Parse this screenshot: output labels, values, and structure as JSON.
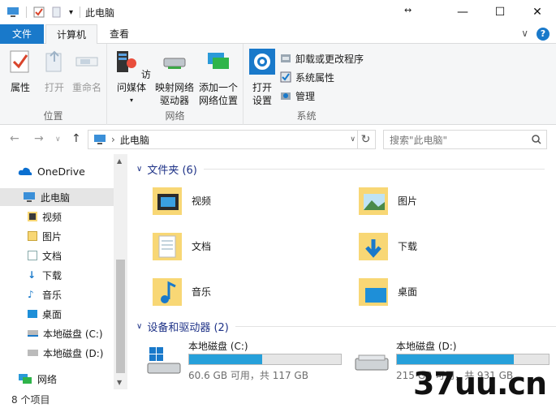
{
  "window": {
    "title": "此电脑",
    "quick_access_dropdown": "▾",
    "controls": {
      "minimize": "—",
      "maximize": "☐",
      "close": "✕"
    },
    "resize_glyph": "↔"
  },
  "tabs": {
    "file": "文件",
    "computer": "计算机",
    "view": "查看",
    "collapse_glyph": "∨",
    "help_glyph": "?"
  },
  "ribbon": {
    "location": {
      "label": "位置",
      "buttons": [
        {
          "label": "属性",
          "icon": "checklist-icon",
          "enabled": true
        },
        {
          "label": "打开",
          "icon": "open-icon",
          "enabled": false
        },
        {
          "label": "重命名",
          "icon": "rename-icon",
          "enabled": false
        }
      ]
    },
    "network": {
      "label": "网络",
      "buttons": [
        {
          "label": "访问媒体",
          "icon": "media-server-icon"
        },
        {
          "label": "映射网络",
          "label2": "驱动器",
          "icon": "map-network-drive-icon"
        },
        {
          "label": "添加一个",
          "label2": "网络位置",
          "icon": "add-network-location-icon"
        }
      ]
    },
    "system": {
      "label": "系统",
      "open_settings": {
        "label": "打开",
        "label2": "设置",
        "icon": "gear-icon"
      },
      "small": [
        {
          "label": "卸载或更改程序",
          "icon": "uninstall-icon"
        },
        {
          "label": "系统属性",
          "icon": "system-properties-icon"
        },
        {
          "label": "管理",
          "icon": "manage-icon"
        }
      ]
    }
  },
  "address": {
    "path": "此电脑",
    "search_placeholder": "搜索\"此电脑\""
  },
  "nav": {
    "onedrive": "OneDrive",
    "this_pc": "此电脑",
    "items": [
      "视频",
      "图片",
      "文档",
      "下载",
      "音乐",
      "桌面",
      "本地磁盘 (C:)",
      "本地磁盘 (D:)"
    ],
    "network": "网络"
  },
  "content": {
    "folders_header": "文件夹 (6)",
    "folders": [
      {
        "name": "视频",
        "icon": "videos-folder-icon"
      },
      {
        "name": "图片",
        "icon": "pictures-folder-icon"
      },
      {
        "name": "文档",
        "icon": "documents-folder-icon"
      },
      {
        "name": "下载",
        "icon": "downloads-folder-icon"
      },
      {
        "name": "音乐",
        "icon": "music-folder-icon"
      },
      {
        "name": "桌面",
        "icon": "desktop-folder-icon"
      }
    ],
    "drives_header": "设备和驱动器 (2)",
    "drives": [
      {
        "name": "本地磁盘 (C:)",
        "info": "60.6 GB 可用，共 117 GB",
        "used_fraction": 0.48
      },
      {
        "name": "本地磁盘 (D:)",
        "info": "215 GB 可用，共 931 GB",
        "used_fraction": 0.77
      }
    ]
  },
  "status": {
    "count": "8 个项目"
  },
  "watermark": "37uu.cn",
  "colors": {
    "accent": "#1979ca",
    "drive_fill": "#26a0da",
    "folder": "#f8d775",
    "header_text": "#1e3287"
  }
}
